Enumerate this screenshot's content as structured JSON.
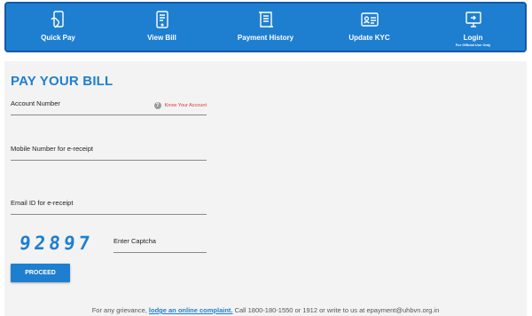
{
  "nav": {
    "items": [
      {
        "label": "Quick Pay",
        "icon": "phone-pay-icon"
      },
      {
        "label": "View Bill",
        "icon": "mobile-bill-icon"
      },
      {
        "label": "Payment History",
        "icon": "scroll-history-icon"
      },
      {
        "label": "Update KYC",
        "icon": "id-card-icon"
      },
      {
        "label": "Login",
        "sub": "For Official Use Only",
        "icon": "login-screen-icon"
      }
    ]
  },
  "form": {
    "title": "PAY YOUR BILL",
    "account_label": "Account Number",
    "know_account": "Know Your Account",
    "mobile_label": "Mobile Number for e-receipt",
    "email_label": "Email ID for e-receipt",
    "captcha_code": "92897",
    "captcha_placeholder": "Enter Captcha",
    "proceed_label": "PROCEED"
  },
  "footer": {
    "prefix": "For any grievance, ",
    "link": "lodge an online complaint.",
    "suffix": " Call 1800-180-1550 or 1912 or write to us at epayment@uhbvn.org.in"
  },
  "colors": {
    "primary": "#1e7fd0",
    "know_link": "#d83a3a",
    "panel": "#f3f3f3"
  }
}
